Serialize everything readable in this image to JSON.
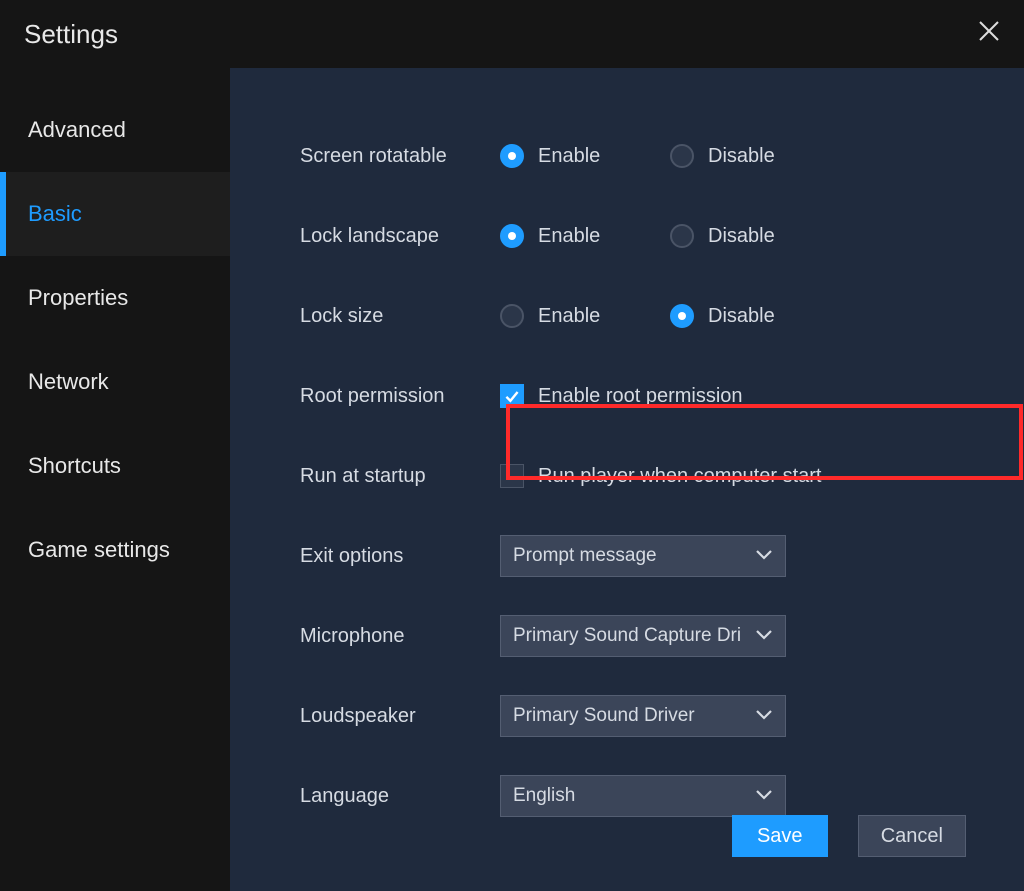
{
  "titlebar": {
    "title": "Settings"
  },
  "sidebar": {
    "items": [
      {
        "label": "Advanced",
        "active": false
      },
      {
        "label": "Basic",
        "active": true
      },
      {
        "label": "Properties",
        "active": false
      },
      {
        "label": "Network",
        "active": false
      },
      {
        "label": "Shortcuts",
        "active": false
      },
      {
        "label": "Game settings",
        "active": false
      }
    ]
  },
  "settings": {
    "screen_rotatable": {
      "label": "Screen rotatable",
      "option_enable": "Enable",
      "option_disable": "Disable",
      "value": "enable"
    },
    "lock_landscape": {
      "label": "Lock landscape",
      "option_enable": "Enable",
      "option_disable": "Disable",
      "value": "enable"
    },
    "lock_size": {
      "label": "Lock size",
      "option_enable": "Enable",
      "option_disable": "Disable",
      "value": "disable"
    },
    "root_permission": {
      "label": "Root permission",
      "checkbox_label": "Enable root permission",
      "checked": true
    },
    "run_at_startup": {
      "label": "Run at startup",
      "checkbox_label": "Run player when computer start",
      "checked": false
    },
    "exit_options": {
      "label": "Exit options",
      "value": "Prompt message"
    },
    "microphone": {
      "label": "Microphone",
      "value": "Primary Sound Capture Dri"
    },
    "loudspeaker": {
      "label": "Loudspeaker",
      "value": "Primary Sound Driver"
    },
    "language": {
      "label": "Language",
      "value": "English"
    }
  },
  "footer": {
    "save": "Save",
    "cancel": "Cancel"
  }
}
